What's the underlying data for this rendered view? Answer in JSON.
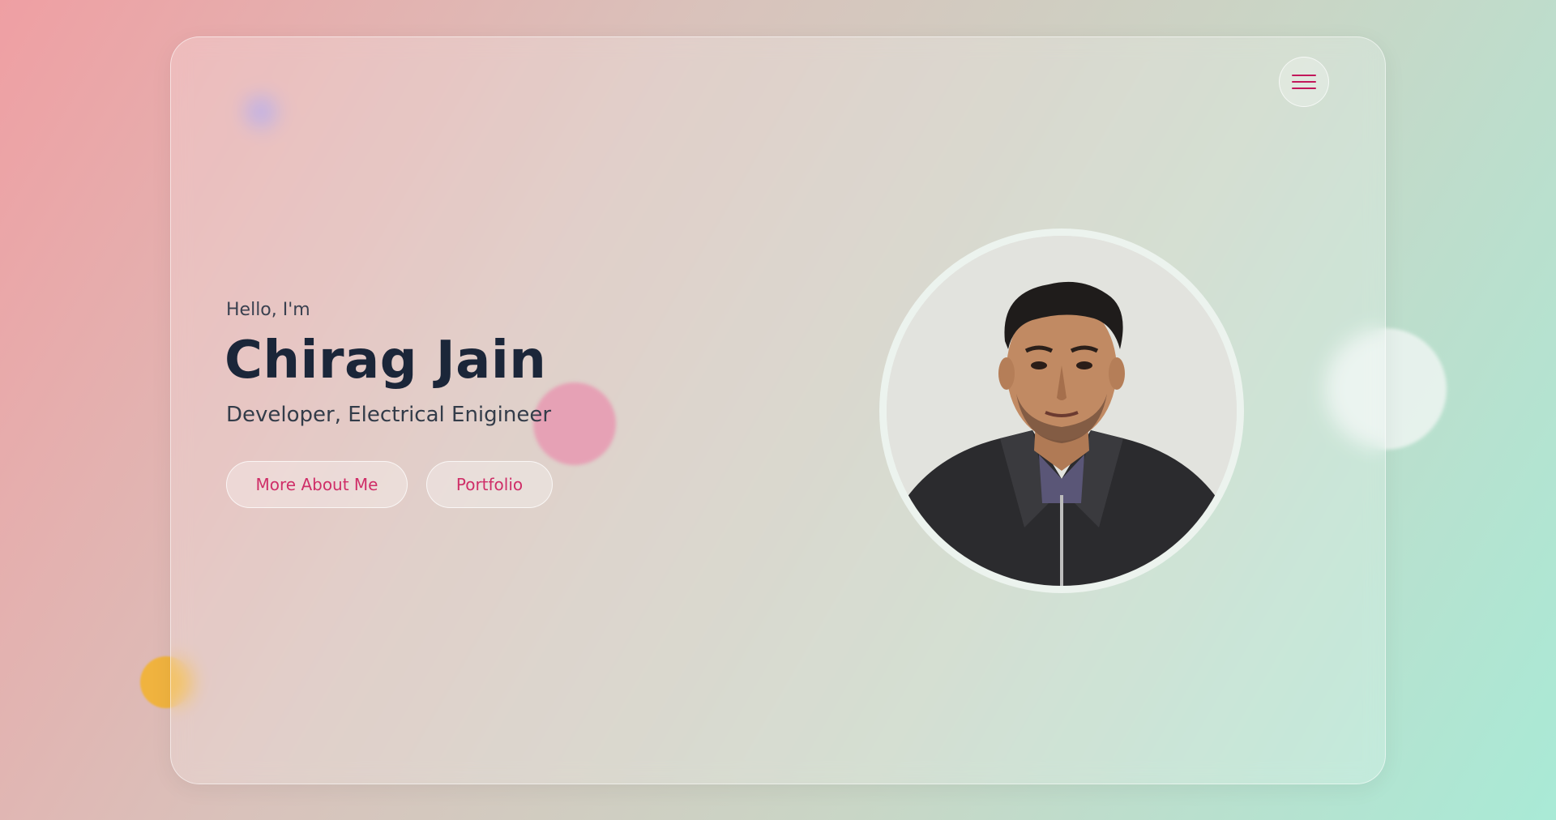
{
  "hero": {
    "greeting": "Hello, I'm",
    "name": "Chirag Jain",
    "role": "Developer, Electrical Enigineer"
  },
  "buttons": {
    "about_label": "More About Me",
    "portfolio_label": "Portfolio"
  },
  "nav": {
    "menu_icon": "hamburger-menu-icon"
  },
  "colors": {
    "accent": "#cf2e68",
    "heading": "#1b2639",
    "background_start": "#ef9fa3",
    "background_end": "#a9ead6"
  }
}
